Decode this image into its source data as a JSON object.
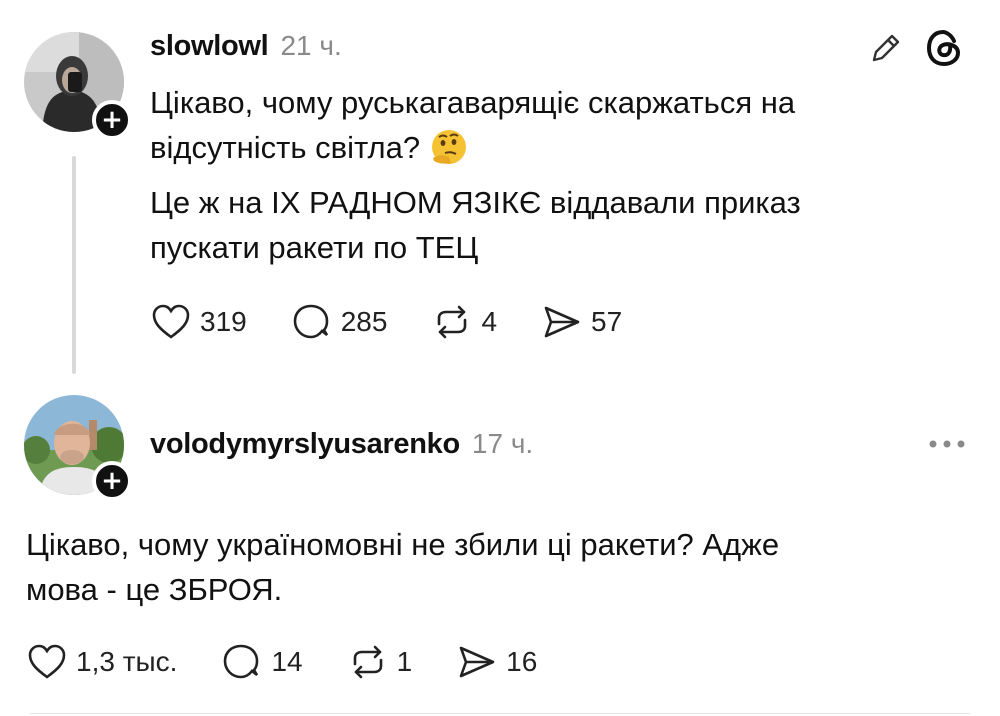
{
  "post1": {
    "username": "slowlowl",
    "time": "21 ч.",
    "paragraph1_line1": "Цікаво, чому руськагаварящіє скаржаться на",
    "paragraph1_line2": "відсутність світла?",
    "paragraph2_line1": "Це ж на ІХ РАДНОМ ЯЗІКЄ віддавали приказ",
    "paragraph2_line2": "пускати ракети по ТЕЦ",
    "emoji": "🤔",
    "likes": "319",
    "comments": "285",
    "reposts": "4",
    "shares": "57",
    "icons": [
      "edit-icon",
      "threads-logo-icon",
      "heart-icon",
      "comment-icon",
      "repost-icon",
      "share-icon"
    ]
  },
  "post2": {
    "username": "volodymyrslyusarenko",
    "time": "17 ч.",
    "line1": "Цікаво, чому україномовні не збили ці ракети? Адже",
    "line2": "мова - це ЗБРОЯ.",
    "likes": "1,3 тыс.",
    "comments": "14",
    "reposts": "1",
    "shares": "16",
    "icons": [
      "more-icon",
      "heart-icon",
      "comment-icon",
      "repost-icon",
      "share-icon"
    ]
  },
  "badge": "+",
  "colors": {
    "text": "#111111",
    "muted": "#8a8a8a",
    "line": "#d9d9d9"
  }
}
